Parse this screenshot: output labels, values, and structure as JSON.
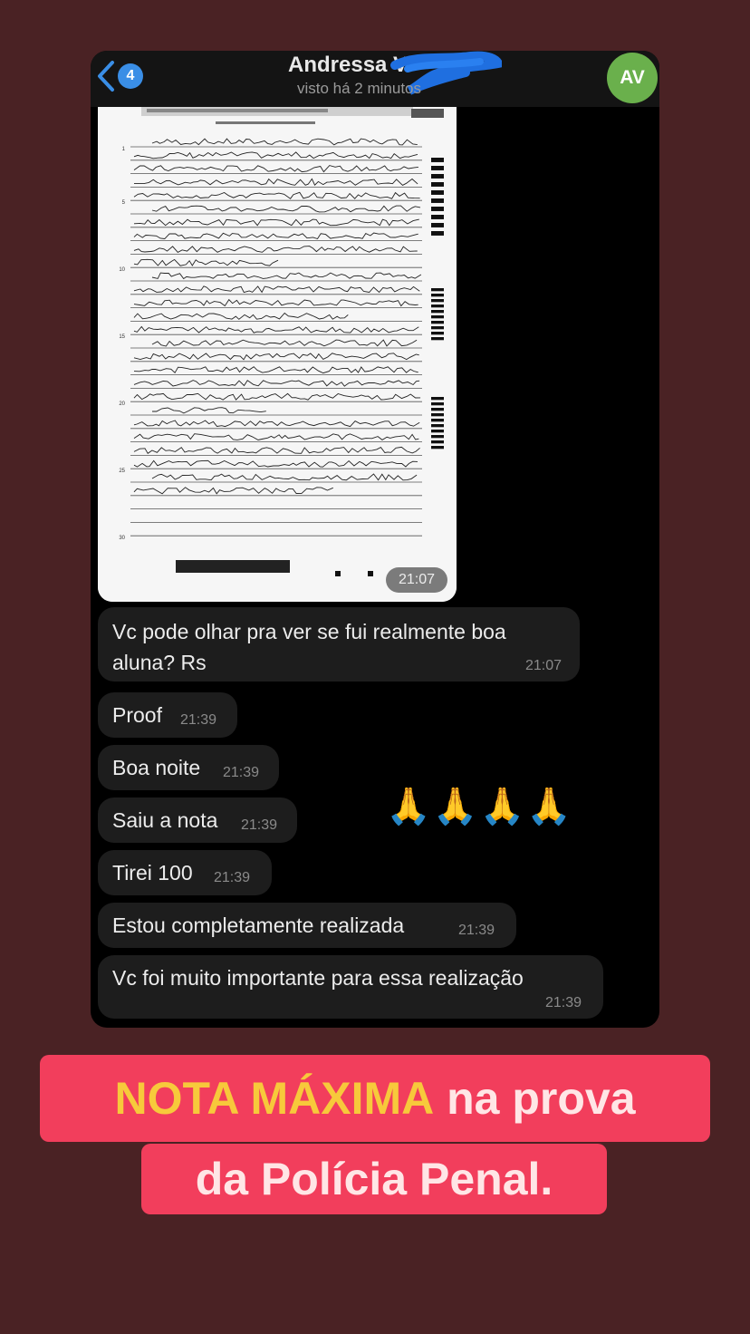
{
  "chat": {
    "back_badge": "4",
    "contact_name": "Andressa V",
    "contact_status": "visto há 2 minutos",
    "avatar_initials": "AV",
    "image_time": "21:07",
    "messages": [
      {
        "line1": "Vc pode olhar pra ver se fui realmente boa",
        "line2": "aluna? Rs",
        "time": "21:07"
      },
      {
        "text": "Proof",
        "time": "21:39"
      },
      {
        "text": "Boa noite",
        "time": "21:39"
      },
      {
        "text": "Saiu a nota",
        "time": "21:39"
      },
      {
        "text": "Tirei 100",
        "time": "21:39"
      },
      {
        "text": "Estou completamente realizada",
        "time": "21:39"
      },
      {
        "text": "Vc foi muito importante para essa realização",
        "time": "21:39"
      }
    ],
    "emojis": "🙏🙏🙏🙏"
  },
  "document": {
    "line_numbers": [
      "1",
      "5",
      "10",
      "15",
      "20",
      "25",
      "30"
    ]
  },
  "caption": {
    "highlight": "NOTA MÁXIMA",
    "line1_rest": " na prova",
    "line2": "da Polícia Penal."
  },
  "colors": {
    "background": "#4a2224",
    "caption_bg": "#f23e5c",
    "highlight": "#f7c93b",
    "bubble": "#1d1d1d"
  }
}
